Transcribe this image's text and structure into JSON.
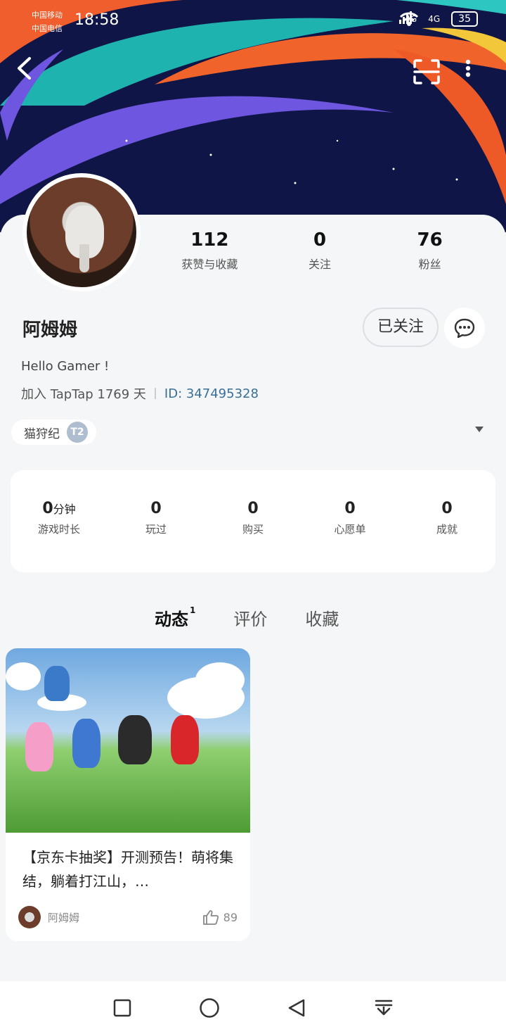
{
  "status": {
    "carrier1": "中国移动",
    "carrier2": "中国电信",
    "time": "18:58",
    "network1": "4G",
    "network2": "4G",
    "battery": "35"
  },
  "profile": {
    "username": "阿姆姆",
    "bio": "Hello Gamer !",
    "join_text": "加入 TapTap 1769 天",
    "id_text": "ID: 347495328",
    "stats": [
      {
        "value": "112",
        "label": "获赞与收藏"
      },
      {
        "value": "0",
        "label": "关注"
      },
      {
        "value": "76",
        "label": "粉丝"
      }
    ],
    "follow_label": "已关注",
    "badge_label": "猫狩纪",
    "badge_level": "T2"
  },
  "game_stats": [
    {
      "value": "0",
      "unit": "分钟",
      "label": "游戏时长"
    },
    {
      "value": "0",
      "unit": "",
      "label": "玩过"
    },
    {
      "value": "0",
      "unit": "",
      "label": "购买"
    },
    {
      "value": "0",
      "unit": "",
      "label": "心愿单"
    },
    {
      "value": "0",
      "unit": "",
      "label": "成就"
    }
  ],
  "tabs": [
    {
      "label": "动态",
      "count": "1"
    },
    {
      "label": "评价"
    },
    {
      "label": "收藏"
    }
  ],
  "post": {
    "title": "【京东卡抽奖】开测预告！萌将集结，躺着打江山，…",
    "author": "阿姆姆",
    "likes": "89"
  }
}
